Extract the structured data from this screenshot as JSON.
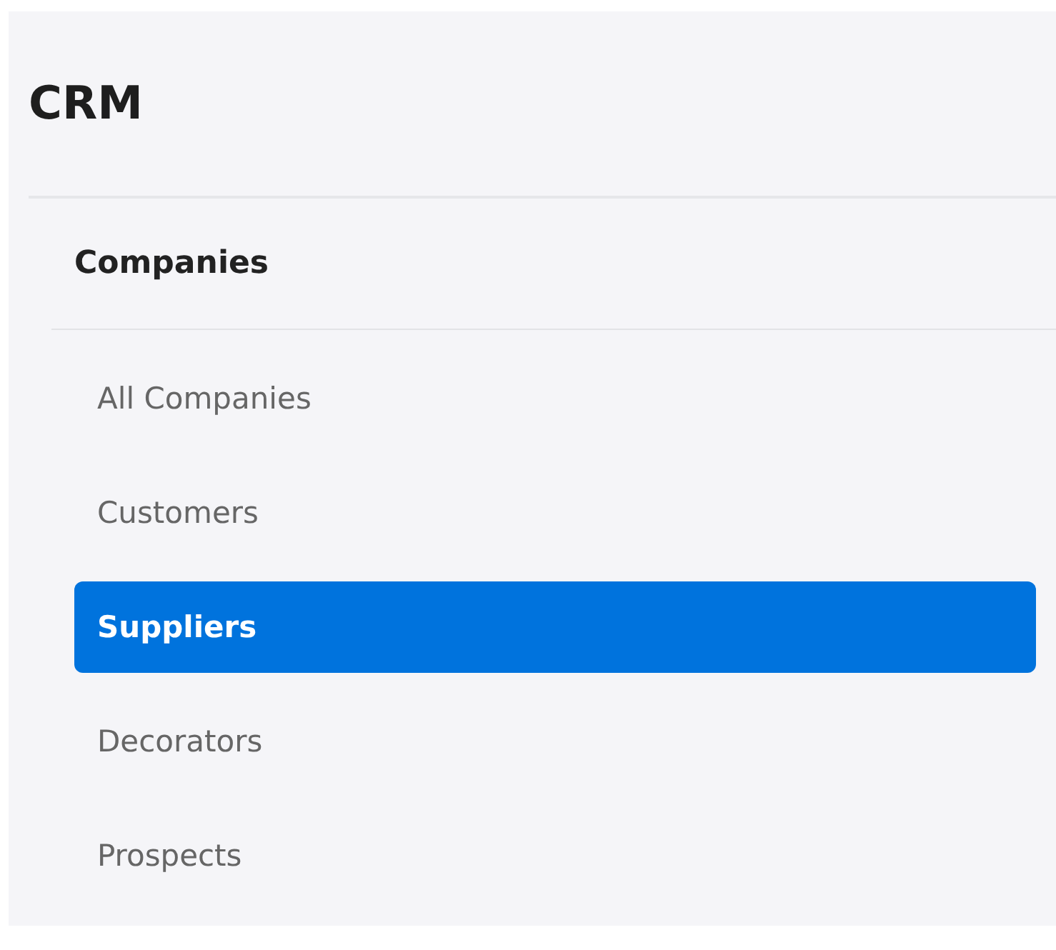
{
  "app_title": "CRM",
  "section": {
    "title": "Companies",
    "items": [
      {
        "label": "All Companies",
        "selected": false
      },
      {
        "label": "Customers",
        "selected": false
      },
      {
        "label": "Suppliers",
        "selected": true
      },
      {
        "label": "Decorators",
        "selected": false
      },
      {
        "label": "Prospects",
        "selected": false
      }
    ]
  }
}
